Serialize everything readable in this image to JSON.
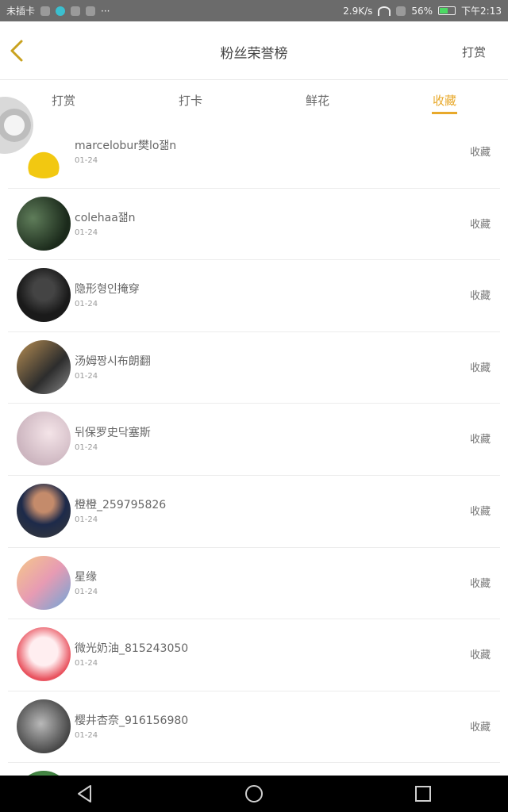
{
  "status_bar": {
    "carrier": "未插卡",
    "speed": "2.9K/s",
    "battery_percent": "56%",
    "battery_level": 0.56,
    "time": "下午2:13",
    "dots": "···"
  },
  "header": {
    "title": "粉丝荣誉榜",
    "action_label": "打赏"
  },
  "tabs": [
    {
      "label": "打赏",
      "active": false
    },
    {
      "label": "打卡",
      "active": false
    },
    {
      "label": "鲜花",
      "active": false
    },
    {
      "label": "收藏",
      "active": true
    }
  ],
  "list": {
    "items": [
      {
        "name": "marcelobur樊lo잶n",
        "date": "01-24",
        "action": "收藏"
      },
      {
        "name": "colehaa잶n",
        "date": "01-24",
        "action": "收藏"
      },
      {
        "name": "隐形형인掩穿",
        "date": "01-24",
        "action": "收藏"
      },
      {
        "name": "汤姆짱시布朗翻",
        "date": "01-24",
        "action": "收藏"
      },
      {
        "name": "뒤保罗史닥塞斯",
        "date": "01-24",
        "action": "收藏"
      },
      {
        "name": "橙橙_259795826",
        "date": "01-24",
        "action": "收藏"
      },
      {
        "name": "星缘",
        "date": "01-24",
        "action": "收藏"
      },
      {
        "name": "微光奶油_815243050",
        "date": "01-24",
        "action": "收藏"
      },
      {
        "name": "樱井杏奈_916156980",
        "date": "01-24",
        "action": "收藏"
      }
    ]
  },
  "nav": {
    "back": "back-triangle",
    "home": "home-circle",
    "recents": "recents-square"
  }
}
